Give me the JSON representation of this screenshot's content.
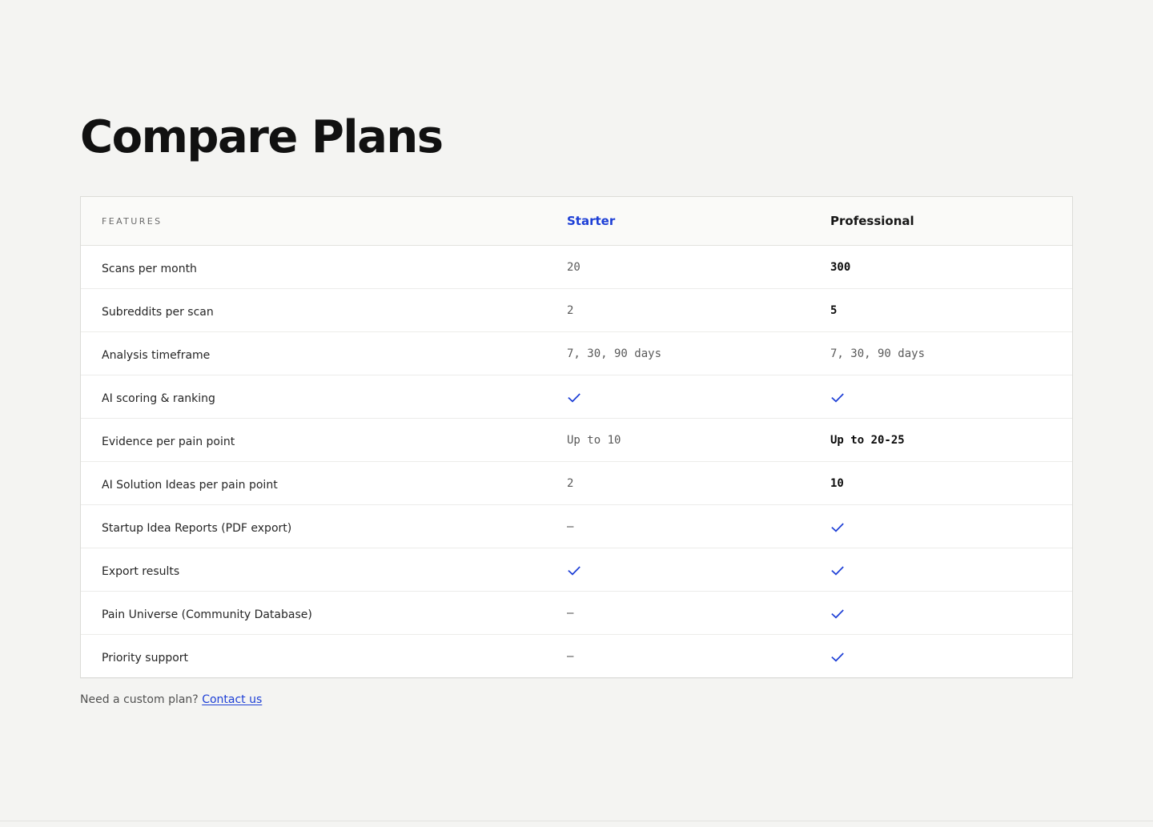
{
  "page_title": "Compare Plans",
  "table": {
    "header": {
      "features": "FEATURES",
      "starter": "Starter",
      "professional": "Professional"
    },
    "rows": [
      {
        "feature": "Scans per month",
        "starter": {
          "type": "text",
          "value": "20"
        },
        "professional": {
          "type": "text",
          "value": "300",
          "emphasis": true
        }
      },
      {
        "feature": "Subreddits per scan",
        "starter": {
          "type": "text",
          "value": "2"
        },
        "professional": {
          "type": "text",
          "value": "5",
          "emphasis": true
        }
      },
      {
        "feature": "Analysis timeframe",
        "starter": {
          "type": "text",
          "value": "7, 30, 90 days"
        },
        "professional": {
          "type": "text",
          "value": "7, 30, 90 days"
        }
      },
      {
        "feature": "AI scoring & ranking",
        "starter": {
          "type": "check"
        },
        "professional": {
          "type": "check"
        }
      },
      {
        "feature": "Evidence per pain point",
        "starter": {
          "type": "text",
          "value": "Up to 10"
        },
        "professional": {
          "type": "text",
          "value": "Up to 20-25",
          "emphasis": true
        }
      },
      {
        "feature": "AI Solution Ideas per pain point",
        "starter": {
          "type": "text",
          "value": "2"
        },
        "professional": {
          "type": "text",
          "value": "10",
          "emphasis": true
        }
      },
      {
        "feature": "Startup Idea Reports (PDF export)",
        "starter": {
          "type": "dash",
          "value": "–"
        },
        "professional": {
          "type": "check"
        }
      },
      {
        "feature": "Export results",
        "starter": {
          "type": "check"
        },
        "professional": {
          "type": "check"
        }
      },
      {
        "feature": "Pain Universe (Community Database)",
        "starter": {
          "type": "dash",
          "value": "–"
        },
        "professional": {
          "type": "check"
        }
      },
      {
        "feature": "Priority support",
        "starter": {
          "type": "dash",
          "value": "–"
        },
        "professional": {
          "type": "check"
        }
      }
    ]
  },
  "footer": {
    "text": "Need a custom plan?",
    "link_label": "Contact us"
  },
  "colors": {
    "accent": "#1d3fd6",
    "background": "#f4f4f2",
    "card": "#ffffff",
    "border": "#dcdcd8"
  },
  "icons": {
    "check": "checkmark-icon"
  }
}
